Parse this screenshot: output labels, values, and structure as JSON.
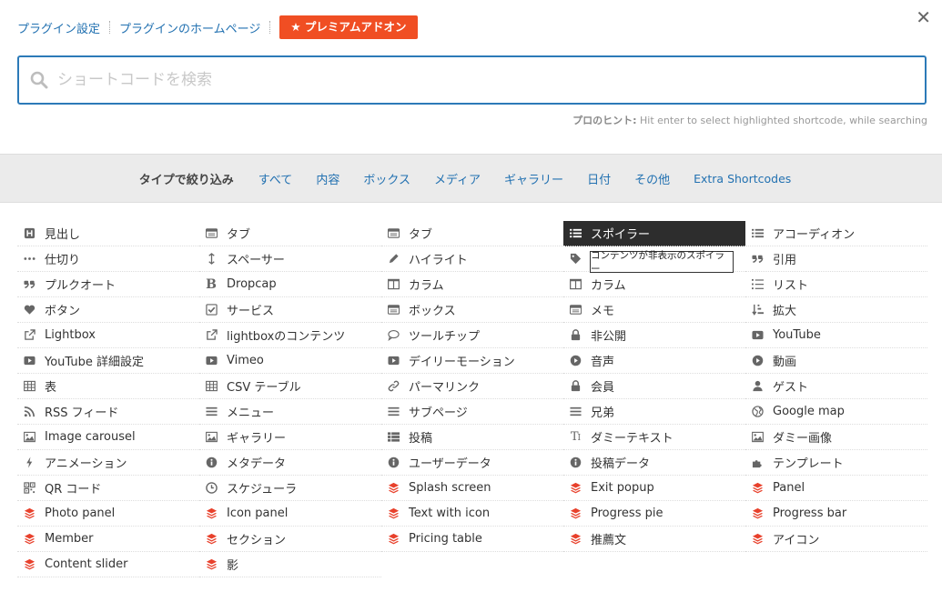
{
  "header": {
    "plugin_settings": "プラグイン設定",
    "plugin_homepage": "プラグインのホームページ",
    "premium": "★ プレミアムアドオン"
  },
  "search": {
    "placeholder": "ショートコードを検索",
    "hint_label": "プロのヒント:",
    "hint_text": " Hit enter to select highlighted shortcode, while searching"
  },
  "filters": {
    "title": "タイプで絞り込み",
    "items": [
      "すべて",
      "内容",
      "ボックス",
      "メディア",
      "ギャラリー",
      "日付",
      "その他",
      "Extra Shortcodes"
    ]
  },
  "tooltip": "コンテンツが非表示のスポイラー",
  "colors": {
    "accent": "#2271b1",
    "premium": "#f04e23",
    "search_border": "#2c7ab8",
    "layer_icon": "#e8412c"
  },
  "grid": [
    [
      {
        "label": "見出し",
        "icon": "heading-icon"
      },
      {
        "label": "タブ",
        "icon": "tab-icon"
      },
      {
        "label": "タブ",
        "icon": "tab-icon"
      },
      {
        "label": "スポイラー",
        "icon": "list-icon"
      },
      {
        "label": "アコーディオン",
        "icon": "list-icon"
      }
    ],
    [
      {
        "label": "仕切り",
        "icon": "divider-icon"
      },
      {
        "label": "スペーサー",
        "icon": "spacer-icon"
      },
      {
        "label": "ハイライト",
        "icon": "pencil-icon"
      },
      {
        "label": "",
        "icon": "tag-icon"
      },
      {
        "label": "引用",
        "icon": "quote-icon"
      }
    ],
    [
      {
        "label": "プルクオート",
        "icon": "quote-icon"
      },
      {
        "label": "Dropcap",
        "icon": "bold-icon"
      },
      {
        "label": "カラム",
        "icon": "columns-icon"
      },
      {
        "label": "カラム",
        "icon": "columns-icon"
      },
      {
        "label": "リスト",
        "icon": "list-ol-icon"
      }
    ],
    [
      {
        "label": "ボタン",
        "icon": "heart-icon"
      },
      {
        "label": "サービス",
        "icon": "check-square-icon"
      },
      {
        "label": "ボックス",
        "icon": "box-icon"
      },
      {
        "label": "メモ",
        "icon": "box-icon"
      },
      {
        "label": "拡大",
        "icon": "sort-icon"
      }
    ],
    [
      {
        "label": "Lightbox",
        "icon": "external-link-icon"
      },
      {
        "label": "lightboxのコンテンツ",
        "icon": "external-link-icon"
      },
      {
        "label": "ツールチップ",
        "icon": "comment-icon"
      },
      {
        "label": "非公開",
        "icon": "lock-icon"
      },
      {
        "label": "YouTube",
        "icon": "youtube-icon"
      }
    ],
    [
      {
        "label": "YouTube 詳細設定",
        "icon": "youtube-icon"
      },
      {
        "label": "Vimeo",
        "icon": "youtube-icon"
      },
      {
        "label": "デイリーモーション",
        "icon": "youtube-icon"
      },
      {
        "label": "音声",
        "icon": "play-circle-icon"
      },
      {
        "label": "動画",
        "icon": "play-circle-icon"
      }
    ],
    [
      {
        "label": "表",
        "icon": "table-icon"
      },
      {
        "label": "CSV テーブル",
        "icon": "table-icon"
      },
      {
        "label": "パーマリンク",
        "icon": "link-icon"
      },
      {
        "label": "会員",
        "icon": "lock-icon"
      },
      {
        "label": "ゲスト",
        "icon": "user-icon"
      }
    ],
    [
      {
        "label": "RSS フィード",
        "icon": "rss-icon"
      },
      {
        "label": "メニュー",
        "icon": "bars-icon"
      },
      {
        "label": "サブページ",
        "icon": "bars-icon"
      },
      {
        "label": "兄弟",
        "icon": "bars-icon"
      },
      {
        "label": "Google map",
        "icon": "globe-icon"
      }
    ],
    [
      {
        "label": "Image carousel",
        "icon": "image-icon"
      },
      {
        "label": "ギャラリー",
        "icon": "image-icon"
      },
      {
        "label": "投稿",
        "icon": "th-list-icon"
      },
      {
        "label": "ダミーテキスト",
        "icon": "text-icon"
      },
      {
        "label": "ダミー画像",
        "icon": "image-icon"
      }
    ],
    [
      {
        "label": "アニメーション",
        "icon": "bolt-icon"
      },
      {
        "label": "メタデータ",
        "icon": "info-icon"
      },
      {
        "label": "ユーザーデータ",
        "icon": "info-icon"
      },
      {
        "label": "投稿データ",
        "icon": "info-icon"
      },
      {
        "label": "テンプレート",
        "icon": "puzzle-icon"
      }
    ],
    [
      {
        "label": "QR コード",
        "icon": "qrcode-icon"
      },
      {
        "label": "スケジューラ",
        "icon": "clock-icon"
      },
      {
        "label": "Splash screen",
        "icon": "layers-icon"
      },
      {
        "label": "Exit popup",
        "icon": "layers-icon"
      },
      {
        "label": "Panel",
        "icon": "layers-icon"
      }
    ],
    [
      {
        "label": "Photo panel",
        "icon": "layers-icon"
      },
      {
        "label": "Icon panel",
        "icon": "layers-icon"
      },
      {
        "label": "Text with icon",
        "icon": "layers-icon"
      },
      {
        "label": "Progress pie",
        "icon": "layers-icon"
      },
      {
        "label": "Progress bar",
        "icon": "layers-icon"
      }
    ],
    [
      {
        "label": "Member",
        "icon": "layers-icon"
      },
      {
        "label": "セクション",
        "icon": "layers-icon"
      },
      {
        "label": "Pricing table",
        "icon": "layers-icon"
      },
      {
        "label": "推薦文",
        "icon": "layers-icon"
      },
      {
        "label": "アイコン",
        "icon": "layers-icon"
      }
    ],
    [
      {
        "label": "Content slider",
        "icon": "layers-icon"
      },
      {
        "label": "影",
        "icon": "layers-icon"
      }
    ]
  ]
}
